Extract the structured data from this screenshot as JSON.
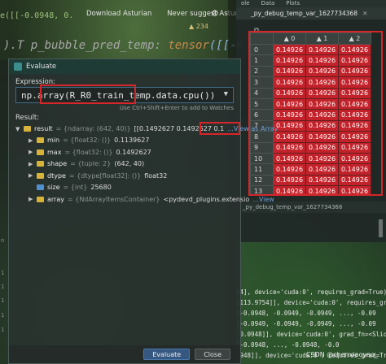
{
  "editor": {
    "code_top": "e([[-0.0948, 0.",
    "code_line2_prefix": ").T",
    "code_line2_var": "p_bubble_pred_temp:",
    "code_line2_type": "tensor",
    "code_line2_value": "([[-0.0948, -0.09",
    "notification": {
      "download_label": "Download Asturian",
      "never_label": "Never suggest Asturian"
    },
    "warning_count": "234",
    "gutter_marks": [
      "n",
      "1",
      "1",
      "1",
      "1",
      "1"
    ],
    "bottom_lines": [
      "24], device='cuda:0', requires_grad=True)",
      "[113.9754]], device='cuda:0', requires_gra",
      "[-0.0948, -0.0949, -0.0949, ..., -0.09",
      "[-0.0949, -0.0949, -0.0949, ..., -0.09",
      "-0.0948]], device='cuda:0', grad_fn=<SliceBa",
      "[-0.0948, ..., -0.0948, -0.0",
      "0948]], device='cuda:0', requires_grad=True)"
    ]
  },
  "dialog": {
    "title": "Evaluate",
    "expression_label": "Expression:",
    "expression_value": "np.array(R_R0_train_temp.data.cpu())",
    "hint": "Use Ctrl+Shift+Enter to add to Watches",
    "result_label": "Result:",
    "result_row": {
      "name": "result",
      "type": "= {ndarray: (642, 40)}",
      "value": "[[0.1492627 0.1492627 0.1",
      "link": "...View as Array"
    },
    "children": [
      {
        "name": "min",
        "type": "= {float32: ()}",
        "value": "0.1139627",
        "link": ""
      },
      {
        "name": "max",
        "type": "= {float32: ()}",
        "value": "0.1492627",
        "link": ""
      },
      {
        "name": "shape",
        "type": "= {tuple: 2}",
        "value": "(642, 40)",
        "link": ""
      },
      {
        "name": "dtype",
        "type": "= {dtype[float32]: ()}",
        "value": "float32",
        "link": ""
      },
      {
        "name": "size",
        "type": "= {int}",
        "value": "25680",
        "link": ""
      },
      {
        "name": "array",
        "type": "= {NdArrayItemsContainer}",
        "value": "<pydevd_plugins.extensio",
        "link": "...View"
      }
    ],
    "evaluate_button": "Evaluate",
    "close_button": "Close"
  },
  "viewer": {
    "top_tabs": [
      "ole",
      "Data",
      "Plots"
    ],
    "tab_title": "_py_debug_temp_var_1627734368",
    "bottom_tab": "_py_debug_temp_var_1627734368",
    "columns": [
      "0",
      "1",
      "2"
    ],
    "rows": [
      "0",
      "1",
      "2",
      "3",
      "4",
      "5",
      "6",
      "7",
      "8",
      "9",
      "10",
      "11",
      "12",
      "13"
    ],
    "cell_value": "0.14926"
  },
  "watermark": "CSDN @chenxiaoyao_"
}
